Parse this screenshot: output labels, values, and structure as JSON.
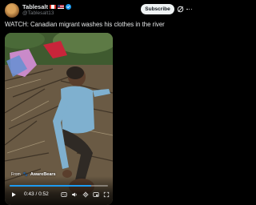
{
  "author": {
    "display_name": "Tablesalt",
    "handle": "@Tablesalt13",
    "flags": [
      "canada-flag",
      "usa-flag"
    ],
    "verified": true
  },
  "actions": {
    "subscribe_label": "Subscribe"
  },
  "tweet": {
    "text": "WATCH: Canadian migrant washes his clothes in the river"
  },
  "video": {
    "watermark_prefix": "From",
    "watermark_brand": "AwareBears",
    "current_time": "0:43",
    "duration": "0:52",
    "time_display": "0:43 / 0:52",
    "progress": 0.83
  },
  "colors": {
    "accent": "#1d9bf0",
    "background": "#000000",
    "text": "#e7e9ea",
    "muted": "#71767b"
  }
}
